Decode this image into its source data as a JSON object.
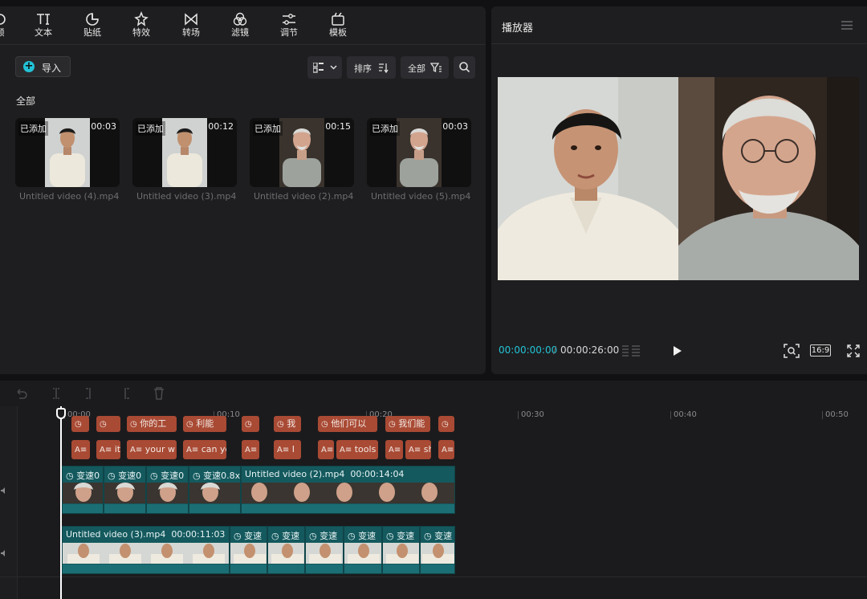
{
  "toolbar": {
    "items": [
      {
        "label": "频",
        "icon": "video-icon"
      },
      {
        "label": "文本",
        "icon": "text-icon"
      },
      {
        "label": "贴纸",
        "icon": "sticker-icon"
      },
      {
        "label": "特效",
        "icon": "effects-icon"
      },
      {
        "label": "转场",
        "icon": "transition-icon"
      },
      {
        "label": "滤镜",
        "icon": "filter-icon"
      },
      {
        "label": "调节",
        "icon": "adjust-icon"
      },
      {
        "label": "模板",
        "icon": "template-icon"
      }
    ]
  },
  "media": {
    "import_label": "导入",
    "sort_label": "排序",
    "filter_label": "全部",
    "section_label": "全部",
    "items": [
      {
        "name": "Untitled video (4).mp4",
        "duration": "00:03",
        "status": "已添加",
        "subject": "young-man"
      },
      {
        "name": "Untitled video (3).mp4",
        "duration": "00:12",
        "status": "已添加",
        "subject": "young-man"
      },
      {
        "name": "Untitled video (2).mp4",
        "duration": "00:15",
        "status": "已添加",
        "subject": "old-man"
      },
      {
        "name": "Untitled video (5).mp4",
        "duration": "00:03",
        "status": "已添加",
        "subject": "old-man"
      }
    ]
  },
  "player": {
    "title": "播放器",
    "current_time": "00:00:00:00",
    "separator": "/",
    "total_time": "00:00:26:00",
    "aspect_ratio": "16:9"
  },
  "timeline": {
    "ruler": [
      "00:00",
      "00:10",
      "00:20",
      "00:30",
      "00:40",
      "00:50"
    ],
    "text_track_top": [
      "",
      "",
      "你的工",
      "利能",
      "",
      "我",
      "他们可以",
      "我们能",
      ""
    ],
    "text_track": [
      "",
      "it",
      "your w",
      "can yo",
      "",
      "I",
      "",
      "tools",
      "",
      "sh",
      ""
    ],
    "video_track_1": {
      "speed_labels": [
        "变速0",
        "变速0",
        "变速0",
        "变速0.8x"
      ],
      "main_label": "Untitled video (2).mp4",
      "main_duration": "00:00:14:04"
    },
    "video_track_2": {
      "main_label": "Untitled video (3).mp4",
      "main_duration": "00:00:11:03",
      "speed_labels": [
        "变速",
        "变速",
        "变速",
        "变速",
        "变速",
        "变速"
      ]
    }
  },
  "colors": {
    "accent": "#22c3d6",
    "text_clip": "#a94a34",
    "video_clip": "#14595e",
    "panel": "#1e1e20"
  }
}
